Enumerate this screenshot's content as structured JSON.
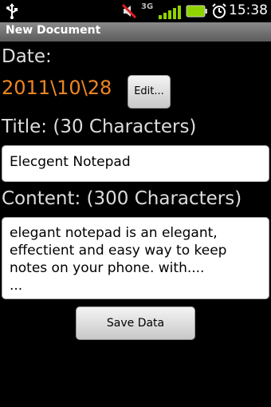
{
  "status_bar": {
    "network": "3G",
    "time": "15:38"
  },
  "title_bar": {
    "title": "New Document"
  },
  "form": {
    "date_label": "Date:",
    "date_value": "2011\\10\\28",
    "edit_button": "Edit...",
    "title_label": "Title: (30 Characters)",
    "title_value": "Elecgent Notepad",
    "content_label": "Content: (300 Characters)",
    "content_value": "elegant notepad is an elegant,\neffectient and easy way to keep\nnotes on your phone. with....\n...",
    "save_button": "Save Data"
  },
  "colors": {
    "date_accent": "#f08523",
    "background": "#000000"
  },
  "icons": [
    "usb-icon",
    "mute-icon",
    "signal-icon",
    "battery-icon",
    "alarm-icon"
  ]
}
